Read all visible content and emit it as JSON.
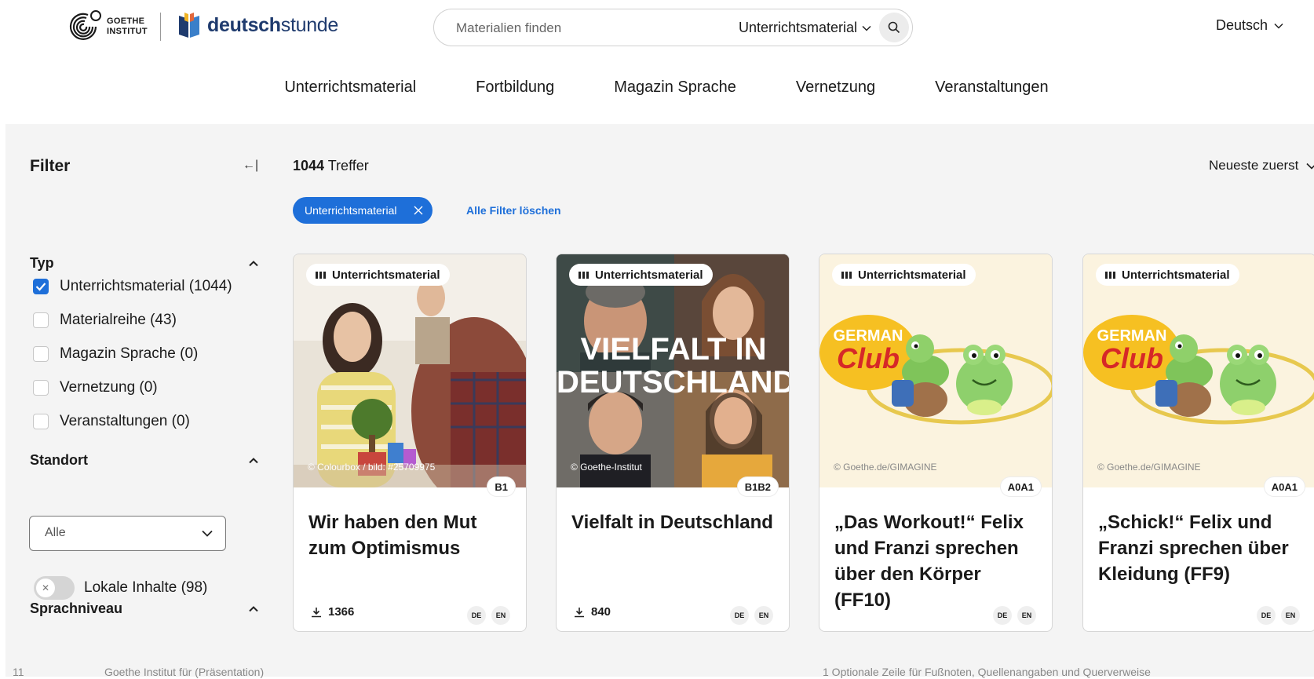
{
  "header": {
    "goethe_logo_line1": "GOETHE",
    "goethe_logo_line2": "INSTITUT",
    "brand_bold": "deutsch",
    "brand_regular": "stunde",
    "search_placeholder": "Materialien finden",
    "search_scope": "Unterrichtsmaterial",
    "language": "Deutsch",
    "nav": [
      "Unterrichtsmaterial",
      "Fortbildung",
      "Magazin Sprache",
      "Vernetzung",
      "Veranstaltungen"
    ]
  },
  "sidebar": {
    "title": "Filter",
    "collapse_icon_text": "←|",
    "typ": {
      "title": "Typ",
      "options": [
        {
          "label": "Unterrichtsmaterial (1044)",
          "checked": true
        },
        {
          "label": "Materialreihe (43)",
          "checked": false
        },
        {
          "label": "Magazin Sprache (0)",
          "checked": false
        },
        {
          "label": "Vernetzung (0)",
          "checked": false
        },
        {
          "label": "Veranstaltungen (0)",
          "checked": false
        }
      ]
    },
    "standort": {
      "title": "Standort",
      "select_value": "Alle",
      "toggle_label": "Lokale Inhalte (98)",
      "toggle_on": false
    },
    "sprachniveau": {
      "title": "Sprachniveau"
    }
  },
  "results": {
    "count": "1044",
    "count_label": "Treffer",
    "sort": "Neueste zuerst",
    "active_filter": "Unterrichtsmaterial",
    "clear_filters": "Alle Filter löschen"
  },
  "cards": [
    {
      "type": "Unterrichtsmaterial",
      "credit": "© Colourbox / bild: #25709975",
      "level": "B1",
      "title": "Wir haben den Mut zum Optimismus",
      "downloads": "1366",
      "langs": [
        "DE",
        "EN"
      ]
    },
    {
      "type": "Unterrichtsmaterial",
      "image_text_1": "VIELFALT IN",
      "image_text_2": "DEUTSCHLAND",
      "credit": "© Goethe-Institut",
      "level": "B1B2",
      "title": "Vielfalt in Deutschland",
      "downloads": "840",
      "langs": [
        "DE",
        "EN"
      ]
    },
    {
      "type": "Unterrichtsmaterial",
      "logo_top": "GERMAN",
      "logo_bottom": "Club",
      "credit": "© Goethe.de/GIMAGINE",
      "level": "A0A1",
      "title": "„Das Workout!“ Felix und Franzi sprechen über den Körper (FF10)",
      "langs": [
        "DE",
        "EN"
      ]
    },
    {
      "type": "Unterrichtsmaterial",
      "logo_top": "GERMAN",
      "logo_bottom": "Club",
      "credit": "© Goethe.de/GIMAGINE",
      "level": "A0A1",
      "title": "„Schick!“ Felix und Franzi sprechen über Kleidung (FF9)",
      "langs": [
        "DE",
        "EN"
      ]
    }
  ],
  "footer_cut": {
    "left_number": "11",
    "left_text": "Goethe Institut für (Präsentation)",
    "right_text": "1 Optionale Zeile für Fußnoten, Quellenangaben und Querverweise"
  },
  "colors": {
    "accent": "#1e6fd9",
    "brand": "#1f3b6e",
    "panel_bg": "#f4f4f4"
  }
}
